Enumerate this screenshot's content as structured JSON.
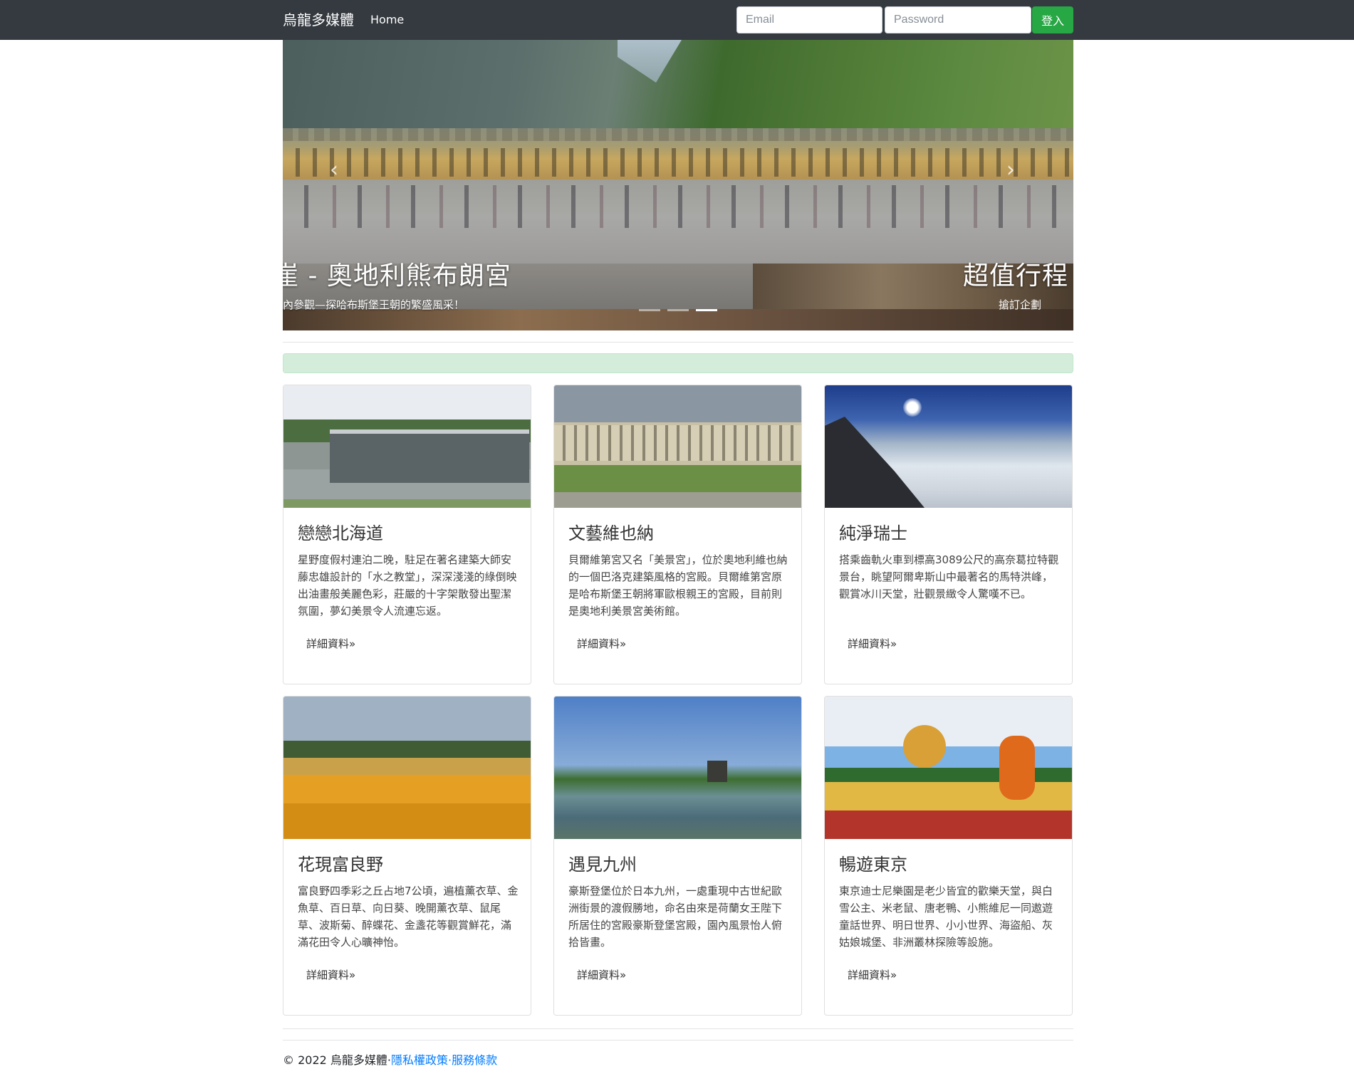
{
  "navbar": {
    "brand": "烏龍多媒體",
    "home": "Home",
    "email_placeholder": "Email",
    "password_placeholder": "Password",
    "login_label": "登入"
  },
  "carousel": {
    "caption_1": "崖 - 奧地利熊布朗宮",
    "sub_1": "內參觀—探哈布斯堡王朝的繁盛風采！",
    "caption_2": "超值行程",
    "sub_2": "搶訂企劃",
    "prev_glyph": "‹",
    "next_glyph": "›"
  },
  "cards": [
    {
      "title": "戀戀北海道",
      "text": "星野度假村連泊二晚，駐足在著名建築大師安藤忠雄設計的「水之教堂」，深深淺淺的綠倒映出油畫般美麗色彩，莊嚴的十字架散發出聖潔氛圍，夢幻美景令人流連忘返。",
      "link": "詳細資料»"
    },
    {
      "title": "文藝維也納",
      "text": "貝爾維第宮又名「美景宮」，位於奧地利維也納的一個巴洛克建築風格的宮殿。貝爾維第宮原是哈布斯堡王朝將軍歐根親王的宮殿，目前則是奧地利美景宮美術館。",
      "link": "詳細資料»"
    },
    {
      "title": "純淨瑞士",
      "text": "搭乘齒軌火車到標高3089公尺的高奈葛拉特觀景台，眺望阿爾卑斯山中最著名的馬特洪峰，觀賞冰川天堂，壯觀景緻令人驚嘆不已。",
      "link": "詳細資料»"
    },
    {
      "title": "花現富良野",
      "text": "富良野四季彩之丘占地7公頃，遍植薰衣草、金魚草、百日草、向日葵、晚開薰衣草、鼠尾草、波斯菊、醉蝶花、金盞花等觀賞鮮花，滿滿花田令人心曠神怡。",
      "link": "詳細資料»"
    },
    {
      "title": "遇見九州",
      "text": "豪斯登堡位於日本九州，一處重現中古世紀歐洲街景的渡假勝地，命名由來是荷蘭女王陛下所居住的宮殿豪斯登堡宮殿，園內風景怡人俯拾皆畫。",
      "link": "詳細資料»"
    },
    {
      "title": "暢遊東京",
      "text": "東京迪士尼樂園是老少皆宜的歡樂天堂，與白雪公主、米老鼠、唐老鴨、小熊維尼一同遨遊童話世界、明日世界、小小世界、海盜船、灰姑娘城堡、非洲叢林探險等設施。",
      "link": "詳細資料»"
    }
  ],
  "footer": {
    "copyright": "© 2022 烏龍多媒體·",
    "privacy": "隱私權政策",
    "separator": "·",
    "terms": "服務條款"
  },
  "colors": {
    "navbar_bg": "#343a40",
    "login_button": "#28a745",
    "alert_bg": "#d4edda",
    "link": "#007bff"
  }
}
